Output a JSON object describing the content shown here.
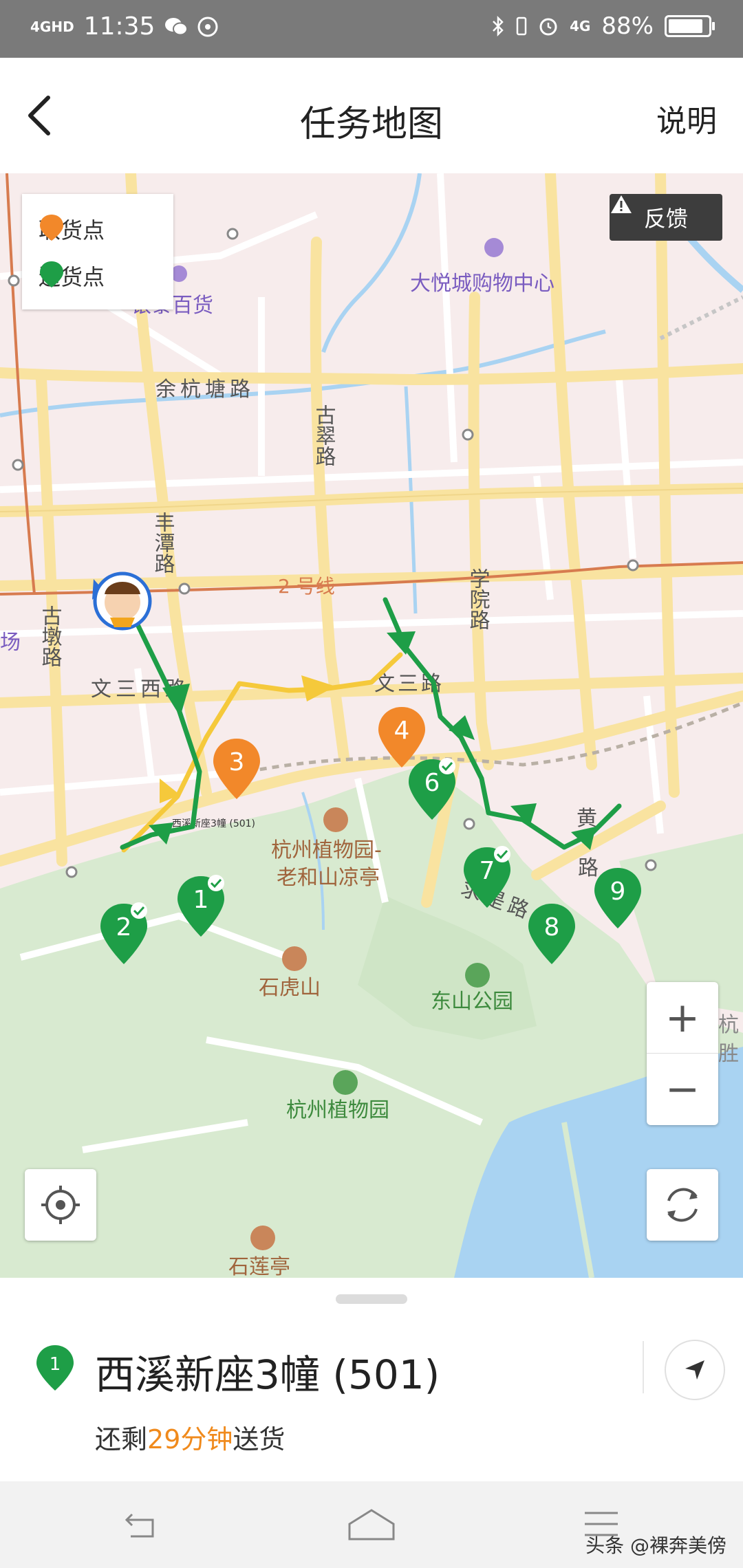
{
  "status_bar": {
    "network": "4GHD",
    "time": "11:35",
    "mobile": "4G",
    "battery": "88%",
    "battery_level": 0.88
  },
  "header": {
    "title": "任务地图",
    "help": "说明"
  },
  "map": {
    "legend": {
      "pickup": "取货点",
      "delivery": "送货点"
    },
    "feedback": "反馈",
    "colors": {
      "pickup": "#f2882a",
      "delivery": "#1e9e47",
      "route_yellow": "#f5c93b"
    },
    "labels": {
      "dayue": "大悦城购物中心",
      "yintai": "银泰百货",
      "yuhang": "余杭塘路",
      "gucui": "古翠路",
      "fengtan": "丰潭路",
      "line2": "2 号线",
      "xueyuan": "学院路",
      "gudun": "古墩路",
      "chang": "场",
      "wensanxi": "文三西路",
      "wensan": "文三路",
      "xixi_small": "西溪新座3幢 (501)",
      "botanical_pavilion_1": "杭州植物园-",
      "botanical_pavilion_2": "老和山凉亭",
      "qiushi": "求是路",
      "huang1": "黄",
      "huang2": "路",
      "shihu": "石虎山",
      "dongshan": "东山公园",
      "botanical": "杭州植物园",
      "shilian": "石莲亭",
      "hang_edge1": "杭",
      "hang_edge2": "胜"
    },
    "markers": [
      {
        "num": "1",
        "type": "delivery",
        "done": true
      },
      {
        "num": "2",
        "type": "delivery",
        "done": true
      },
      {
        "num": "3",
        "type": "pickup",
        "done": false
      },
      {
        "num": "4",
        "type": "pickup",
        "done": false
      },
      {
        "num": "6",
        "type": "delivery",
        "done": true
      },
      {
        "num": "7",
        "type": "delivery",
        "done": true
      },
      {
        "num": "8",
        "type": "delivery",
        "done": false
      },
      {
        "num": "9",
        "type": "delivery",
        "done": false
      }
    ],
    "zoom_in": "+",
    "zoom_out": "−"
  },
  "task": {
    "pin_num": "1",
    "name": "西溪新座3幢 (501)",
    "remaining_prefix": "还剩",
    "remaining_time": "29分钟",
    "remaining_suffix": "送货"
  },
  "watermark": "头条 @裸奔美傍"
}
